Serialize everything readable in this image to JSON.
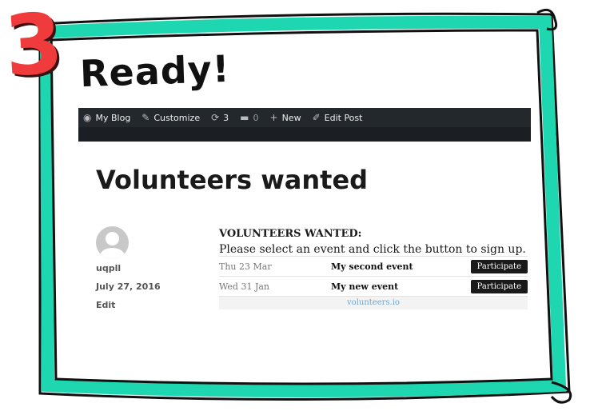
{
  "step": {
    "number": "3",
    "title": "Ready!"
  },
  "admin_bar": {
    "items": [
      {
        "icon": "dashboard-icon",
        "label": "My Blog"
      },
      {
        "icon": "brush-icon",
        "label": "Customize"
      },
      {
        "icon": "refresh-icon",
        "label": "3"
      },
      {
        "icon": "comment-icon",
        "label": "0"
      },
      {
        "icon": "plus-icon",
        "label": "New"
      },
      {
        "icon": "pencil-icon",
        "label": "Edit Post"
      }
    ]
  },
  "post": {
    "title": "Volunteers wanted",
    "author": "uqpll",
    "date": "July 27, 2016",
    "edit_label": "Edit"
  },
  "volunteer_widget": {
    "heading": "VOLUNTEERS WANTED:",
    "instruction": "Please select an event and click the button to sign up.",
    "events": [
      {
        "date": "Thu 23 Mar",
        "name": "My second event",
        "button": "Participate"
      },
      {
        "date": "Wed 31 Jan",
        "name": "My new event",
        "button": "Participate"
      }
    ],
    "footer_link": "volunteers.io"
  },
  "colors": {
    "frame": "#1ed6b0",
    "number": "#ef3b3b",
    "admin_bar": "#23282d",
    "link": "#6aa8d8"
  }
}
